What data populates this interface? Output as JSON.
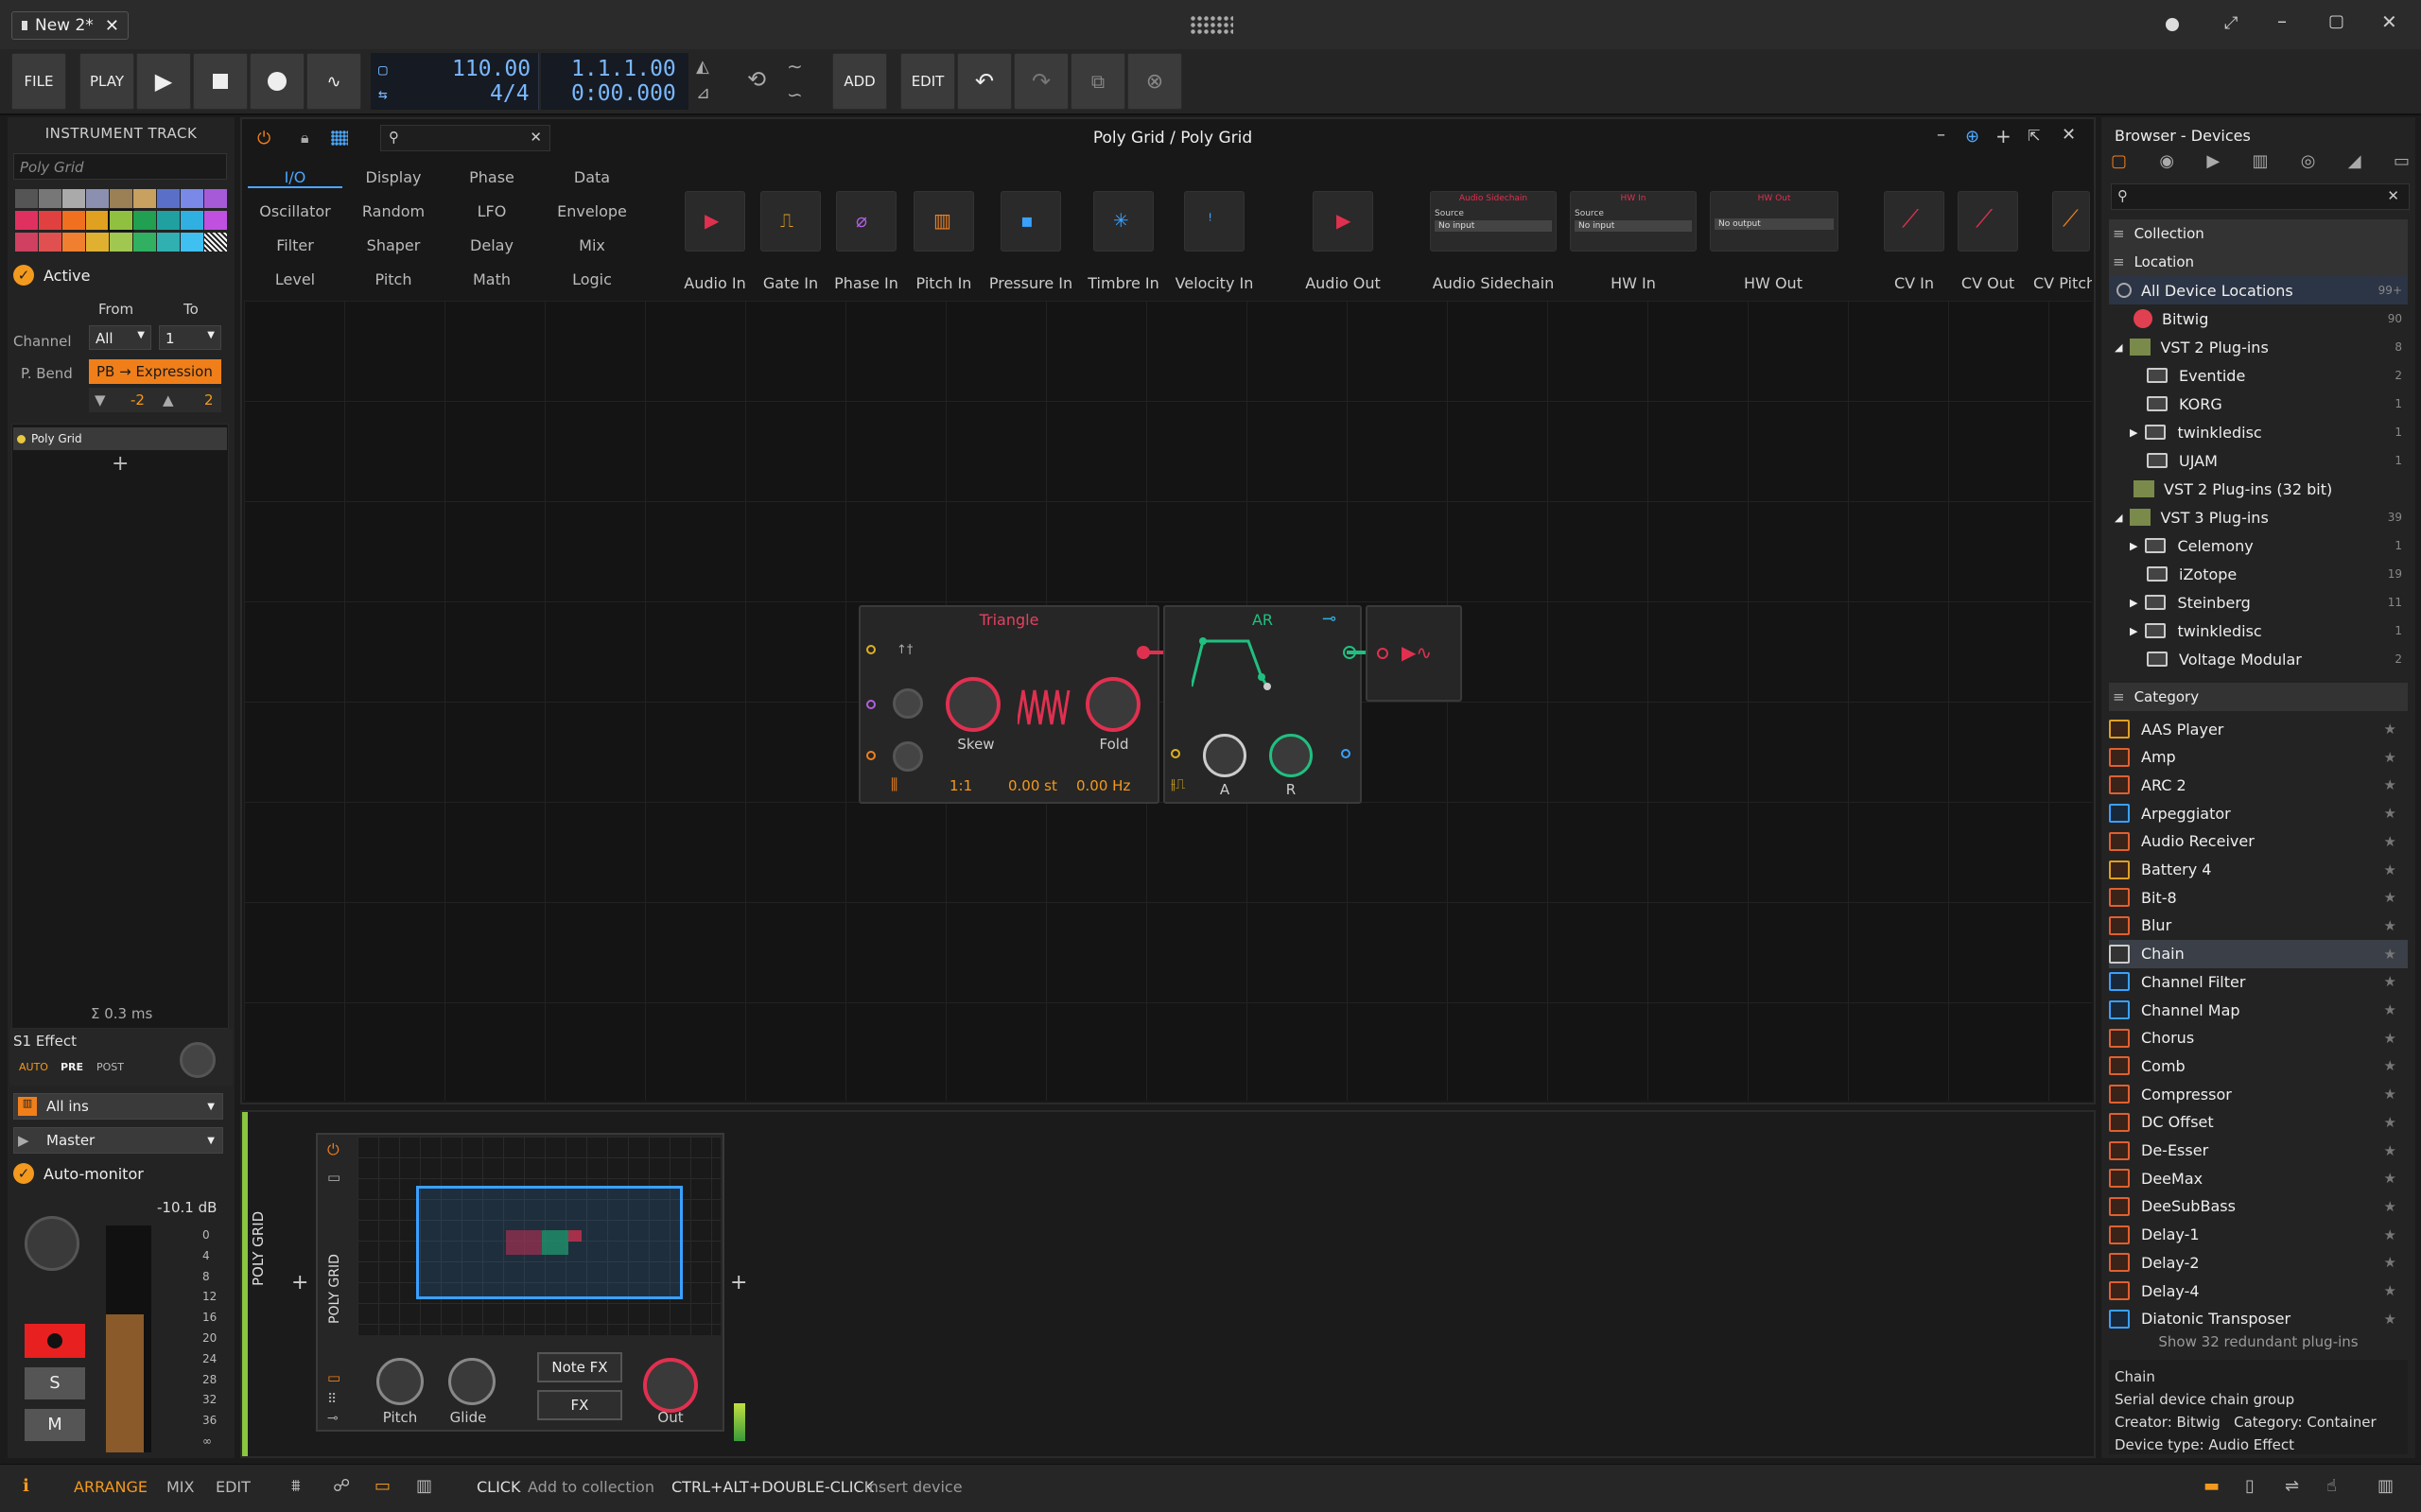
{
  "window": {
    "tab_title": "New 2*",
    "tab_close": "✕"
  },
  "transport": {
    "file": "FILE",
    "play_label": "PLAY",
    "add": "ADD",
    "edit": "EDIT",
    "tempo": "110.00",
    "signature": "4/4",
    "position": "1.1.1.00",
    "time": "0:00.000"
  },
  "left": {
    "header": "INSTRUMENT TRACK",
    "track_name": "Poly Grid",
    "active": "Active",
    "from": "From",
    "to": "To",
    "channel_label": "Channel",
    "channel_from": "All",
    "channel_to": "1",
    "pbend_label": "P. Bend",
    "pbend_value": "PB → Expression",
    "pb_down": "-2",
    "pb_up": "2",
    "device": "Poly Grid",
    "plus": "+",
    "cpu": "Σ 0.3 ms",
    "effect_label": "S1 Effect",
    "auto": "AUTO",
    "pre": "PRE",
    "post": "POST",
    "input": "All ins",
    "output": "Master",
    "automonitor": "Auto-monitor",
    "db": "-10.1 dB",
    "meter_ticks": [
      "0",
      "4",
      "8",
      "12",
      "16",
      "20",
      "24",
      "28",
      "32",
      "36",
      "∞"
    ],
    "solo": "S",
    "mute": "M",
    "colors": [
      "#555",
      "#777",
      "#aaa",
      "#8b90b0",
      "#9b7f55",
      "#c8a060",
      "#5a70c8",
      "#7a88e8",
      "#a65ad8",
      "#e03060",
      "#e04040",
      "#f07020",
      "#e0a020",
      "#90c040",
      "#20a050",
      "#20a0a0",
      "#30b0e0",
      "#ffffff"
    ]
  },
  "editor": {
    "title": "Poly Grid / Poly Grid",
    "categories": [
      [
        "I/O",
        "Display",
        "Phase",
        "Data"
      ],
      [
        "Oscillator",
        "Random",
        "LFO",
        "Envelope"
      ],
      [
        "Filter",
        "Shaper",
        "Delay",
        "Mix"
      ],
      [
        "Level",
        "Pitch",
        "Math",
        "Logic"
      ]
    ],
    "io_modules": [
      {
        "label": "Audio In",
        "color": "#e03050",
        "glyph": "▶"
      },
      {
        "label": "Gate In",
        "color": "#e0a020",
        "glyph": "⎍"
      },
      {
        "label": "Phase In",
        "color": "#b060e0",
        "glyph": "⌀"
      },
      {
        "label": "Pitch In",
        "color": "#f08020",
        "glyph": "▥"
      },
      {
        "label": "Pressure In",
        "color": "#3aa0ff",
        "glyph": "▪"
      },
      {
        "label": "Timbre In",
        "color": "#3aa0ff",
        "glyph": "✳"
      },
      {
        "label": "Velocity In",
        "color": "#3aa0ff",
        "glyph": "ꜝ"
      },
      {
        "label": "Audio Out",
        "color": "#e03050",
        "glyph": "▶"
      }
    ],
    "hw_modules": [
      {
        "label": "Audio Sidechain",
        "head": "Audio Sidechain",
        "source": "Source",
        "value": "No input"
      },
      {
        "label": "HW In",
        "head": "HW In",
        "source": "Source",
        "value": "No input"
      },
      {
        "label": "HW Out",
        "head": "HW Out",
        "source": "",
        "value": "No output"
      }
    ],
    "cv_modules": [
      {
        "label": "CV In"
      },
      {
        "label": "CV Out"
      },
      {
        "label": "CV Pitch"
      }
    ],
    "osc": {
      "title": "Triangle",
      "skew": "Skew",
      "fold": "Fold",
      "ratio": "1:1",
      "semis": "0.00 st",
      "hz": "0.00 Hz"
    },
    "env": {
      "title": "AR",
      "a": "A",
      "r": "R"
    }
  },
  "bottom": {
    "track_vertical": "POLY GRID",
    "device_vertical": "POLY GRID",
    "pitch": "Pitch",
    "glide": "Glide",
    "notefx": "Note FX",
    "fx": "FX",
    "out": "Out",
    "plus": "+"
  },
  "browser": {
    "title": "Browser - Devices",
    "collection": "Collection",
    "location": "Location",
    "locations": [
      {
        "name": "All Device Locations",
        "count": "99+",
        "indent": 0,
        "kind": "all"
      },
      {
        "name": "Bitwig",
        "count": "90",
        "indent": 0,
        "kind": "bitwig"
      },
      {
        "name": "VST 2 Plug-ins",
        "count": "8",
        "indent": 0,
        "kind": "plug"
      },
      {
        "name": "Eventide",
        "count": "2",
        "indent": 1,
        "kind": "folder"
      },
      {
        "name": "KORG",
        "count": "1",
        "indent": 1,
        "kind": "folder"
      },
      {
        "name": "twinkledisc",
        "count": "1",
        "indent": 1,
        "kind": "folder"
      },
      {
        "name": "UJAM",
        "count": "1",
        "indent": 1,
        "kind": "folder"
      },
      {
        "name": "VST 2 Plug-ins (32 bit)",
        "count": "",
        "indent": 0,
        "kind": "plug"
      },
      {
        "name": "VST 3 Plug-ins",
        "count": "39",
        "indent": 0,
        "kind": "plug"
      },
      {
        "name": "Celemony",
        "count": "1",
        "indent": 1,
        "kind": "folder"
      },
      {
        "name": "iZotope",
        "count": "19",
        "indent": 1,
        "kind": "folder"
      },
      {
        "name": "Steinberg",
        "count": "11",
        "indent": 1,
        "kind": "folder"
      },
      {
        "name": "twinkledisc",
        "count": "1",
        "indent": 1,
        "kind": "folder"
      },
      {
        "name": "Voltage Modular",
        "count": "2",
        "indent": 1,
        "kind": "folder"
      }
    ],
    "category": "Category",
    "devices": [
      "AAS Player",
      "Amp",
      "ARC 2",
      "Arpeggiator",
      "Audio Receiver",
      "Battery 4",
      "Bit-8",
      "Blur",
      "Chain",
      "Channel Filter",
      "Channel Map",
      "Chorus",
      "Comb",
      "Compressor",
      "DC Offset",
      "De-Esser",
      "DeeMax",
      "DeeSubBass",
      "Delay-1",
      "Delay-2",
      "Delay-4",
      "Diatonic Transposer"
    ],
    "redundant": "Show 32 redundant plug-ins",
    "info_name": "Chain",
    "info_desc": "Serial device chain group",
    "info_creator": "Creator: Bitwig",
    "info_category": "Category: Container",
    "info_type": "Device type: Audio Effect"
  },
  "status": {
    "arrange": "ARRANGE",
    "mix": "MIX",
    "edit": "EDIT",
    "click": "CLICK",
    "click_action": "Add to collection",
    "combo": "CTRL+ALT+DOUBLE-CLICK",
    "combo_action": "Insert device"
  }
}
